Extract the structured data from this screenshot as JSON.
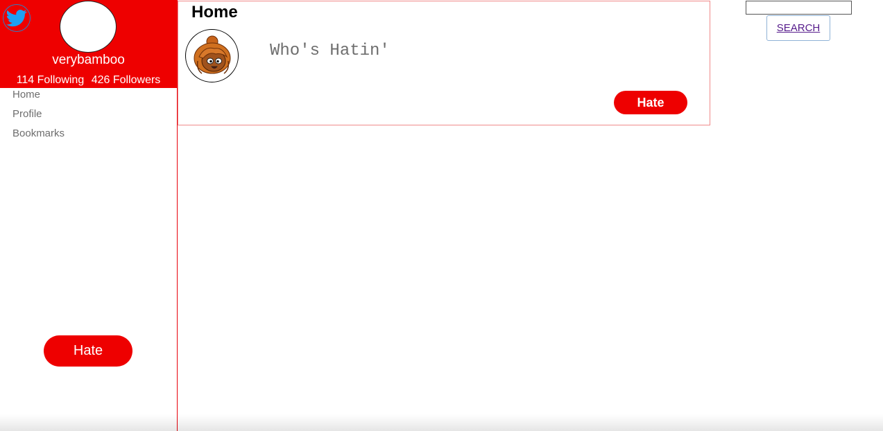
{
  "sidebar": {
    "logo_icon": "twitter-bird-icon",
    "username": "verybamboo",
    "following": "114 Following",
    "followers": "426 Followers",
    "nav_items": [
      {
        "label": "Home"
      },
      {
        "label": "Profile"
      },
      {
        "label": "Bookmarks"
      }
    ],
    "hate_button_label": "Hate"
  },
  "main": {
    "title": "Home",
    "compose": {
      "placeholder": "Who's Hatin'",
      "value": "",
      "submit_label": "Hate"
    }
  },
  "search": {
    "value": "",
    "button_label": "SEARCH"
  },
  "colors": {
    "brand_red": "#ee0000",
    "twitter_blue": "#1da1f2",
    "link_purple": "#551a8b"
  }
}
